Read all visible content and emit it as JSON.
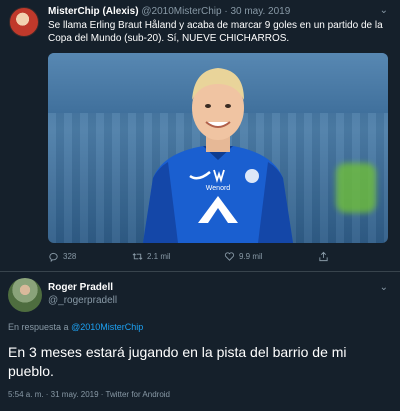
{
  "tweet1": {
    "display_name": "MisterChip (Alexis)",
    "handle": "@2010MisterChip",
    "separator": "·",
    "date": "30 may. 2019",
    "text": "Se llama Erling Braut Håland y acaba de marcar 9 goles en un partido de la Copa del Mundo (sub-20). Sí, NUEVE CHICHARROS.",
    "jersey_text": "Wenord",
    "actions": {
      "replies": "328",
      "retweets": "2.1 mil",
      "likes": "9.9 mil"
    }
  },
  "tweet2": {
    "display_name": "Roger Pradell",
    "handle": "@_rogerpradell",
    "reply_prefix": "En respuesta a",
    "reply_to": "@2010MisterChip",
    "text": "En 3 meses estará jugando en la pista del barrio de mi pueblo.",
    "meta": "5:54 a. m. · 31 may. 2019 · Twitter for Android"
  },
  "icons": {
    "more": "chevron-down-icon",
    "reply": "reply-icon",
    "retweet": "retweet-icon",
    "like": "heart-icon",
    "share": "share-icon"
  },
  "colors": {
    "background": "#15202b",
    "text": "#ffffff",
    "muted": "#8899a6",
    "link": "#1da1f2",
    "divider": "#38444d"
  }
}
